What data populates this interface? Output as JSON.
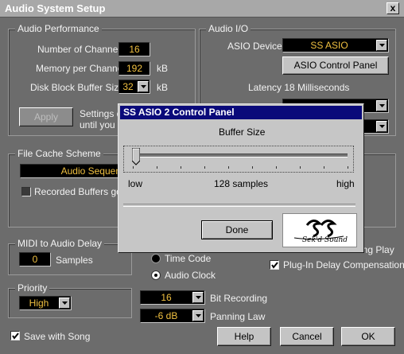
{
  "window": {
    "title": "Audio System Setup",
    "close": "x"
  },
  "audio_performance": {
    "title": "Audio Performance",
    "channels_label": "Number of Channels",
    "channels_value": "16",
    "memory_label": "Memory per Channel",
    "memory_value": "192",
    "memory_unit": "kB",
    "buffer_label": "Disk Block Buffer Size",
    "buffer_value": "32",
    "buffer_unit": "kB",
    "apply_label": "Apply",
    "settings_text1": "Settings d",
    "settings_text2": "until you c"
  },
  "audio_io": {
    "title": "Audio I/O",
    "asio_label": "ASIO Device",
    "asio_value": "SS ASIO",
    "control_panel_label": "ASIO Control Panel",
    "latency": "Latency 18 Milliseconds"
  },
  "file_cache": {
    "title": "File Cache Scheme",
    "value": "Audio Sequenc",
    "recorded_label": "Recorded Buffers go c"
  },
  "midi_delay": {
    "title": "MIDI to Audio Delay",
    "value": "0",
    "unit": "Samples"
  },
  "sync": {
    "time_code": "Time Code",
    "audio_clock": "Audio Clock"
  },
  "priority": {
    "title": "Priority",
    "value": "High"
  },
  "bit_recording": {
    "value": "16",
    "label": "Bit Recording"
  },
  "panning": {
    "value": "-6 dB",
    "label": "Panning Law"
  },
  "right_checks": {
    "during_play": "ing Play",
    "plugin_delay": "Plug-In Delay Compensation"
  },
  "save_with_song": "Save with Song",
  "buttons": {
    "help": "Help",
    "cancel": "Cancel",
    "ok": "OK"
  },
  "dialog": {
    "title": "SS ASIO 2 Control Panel",
    "buffer_title": "Buffer Size",
    "low": "low",
    "samples": "128 samples",
    "high": "high",
    "slider_fraction": 0.0,
    "done": "Done",
    "logo_text": "Sek'd Sound"
  },
  "colors": {
    "value_text": "#f0c040",
    "title_bar": "#0a0a7a"
  }
}
